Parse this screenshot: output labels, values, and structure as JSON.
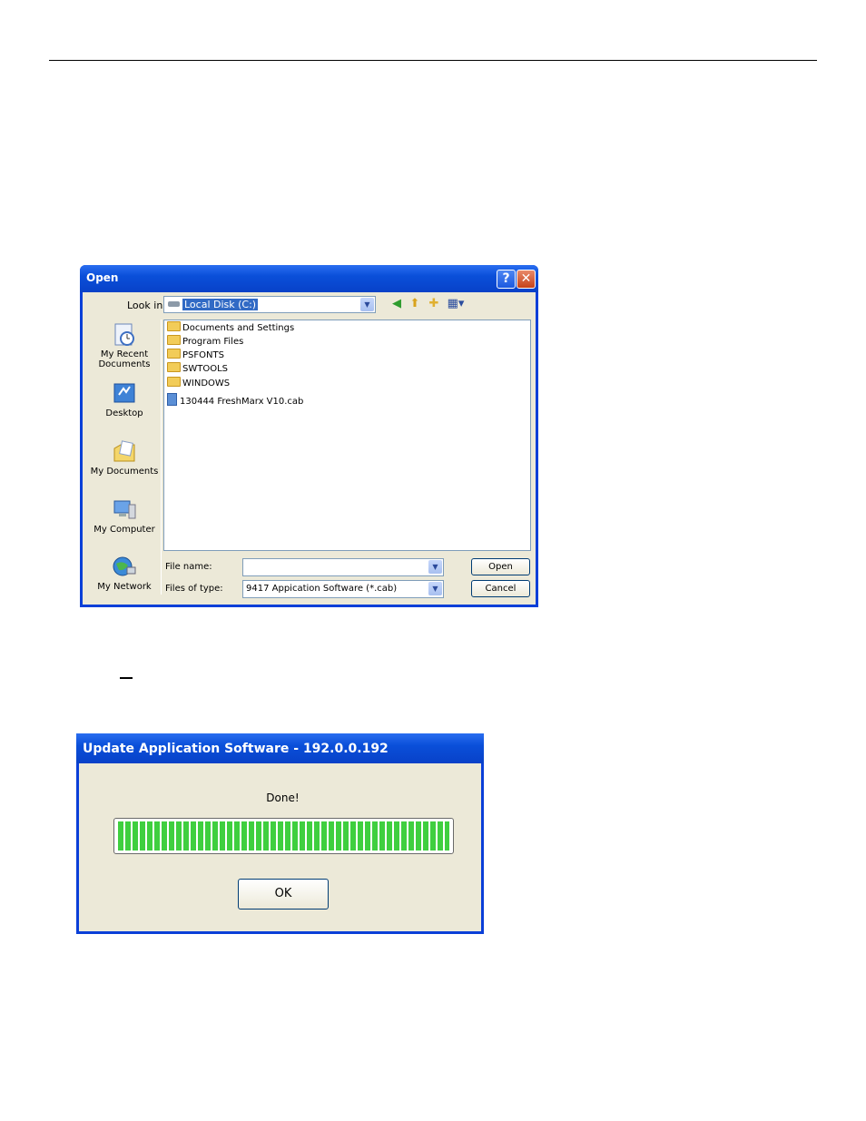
{
  "open_dialog": {
    "title": "Open",
    "help_glyph": "?",
    "close_glyph": "✕",
    "look_in_label": "Look in:",
    "look_in_value": "Local Disk (C:)",
    "places": [
      {
        "label_line1": "My Recent",
        "label_line2": "Documents",
        "icon": "recent-documents-icon"
      },
      {
        "label_line1": "Desktop",
        "label_line2": "",
        "icon": "desktop-icon"
      },
      {
        "label_line1": "My Documents",
        "label_line2": "",
        "icon": "my-documents-icon"
      },
      {
        "label_line1": "My Computer",
        "label_line2": "",
        "icon": "my-computer-icon"
      },
      {
        "label_line1": "My Network",
        "label_line2": "",
        "icon": "my-network-icon"
      }
    ],
    "files": [
      {
        "name": "Documents and Settings",
        "type": "folder"
      },
      {
        "name": "Program Files",
        "type": "folder"
      },
      {
        "name": "PSFONTS",
        "type": "folder"
      },
      {
        "name": "SWTOOLS",
        "type": "folder"
      },
      {
        "name": "WINDOWS",
        "type": "folder"
      },
      {
        "name": "130444 FreshMarx V10.cab",
        "type": "cab"
      }
    ],
    "file_name_label": "File name:",
    "file_name_value": "",
    "files_of_type_label": "Files of type:",
    "files_of_type_value": "9417 Appication Software (*.cab)",
    "open_button": "Open",
    "cancel_button": "Cancel"
  },
  "update_dialog": {
    "title": "Update Application Software - 192.0.0.192",
    "status": "Done!",
    "progress_fraction": 1.0,
    "ok_button": "OK"
  },
  "colors": {
    "xp_title_blue": "#0a4fd9",
    "dialog_face": "#ece9d8",
    "progress_green": "#3fcf3f"
  }
}
